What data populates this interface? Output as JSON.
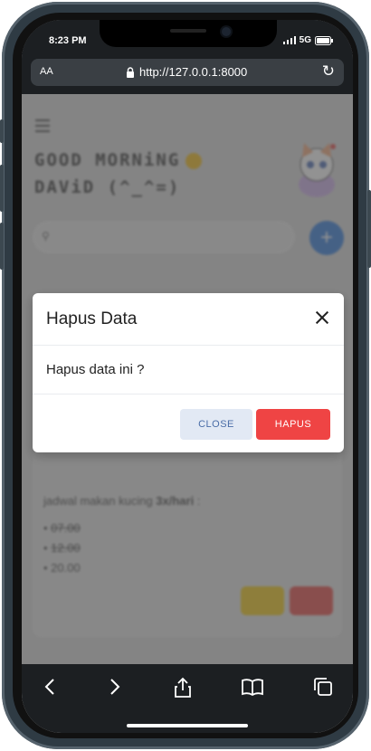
{
  "status": {
    "time": "8:23 PM",
    "network": "5G"
  },
  "browser": {
    "text_size": "AA",
    "url": "http://127.0.0.1:8000"
  },
  "app": {
    "greeting_line1": "GOOD MORNiNG",
    "greeting_line2": "DAViD (^_^=)",
    "schedule_prefix": "jadwal makan kucing ",
    "schedule_bold": "3x/hari",
    "schedule_suffix": " :",
    "items": [
      "07.00",
      "12.00",
      "20.00"
    ]
  },
  "modal": {
    "title": "Hapus Data",
    "message": "Hapus data ini ?",
    "close_label": "CLOSE",
    "confirm_label": "HAPUS"
  },
  "colors": {
    "primary": "#1e6fd9",
    "danger": "#ef4444",
    "warning": "#f2c500"
  }
}
